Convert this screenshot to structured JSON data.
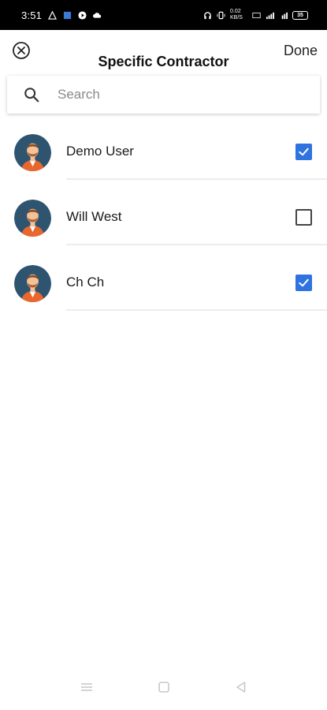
{
  "status_bar": {
    "time": "3:51",
    "network_text": "0.02 KB/S",
    "battery": "35"
  },
  "header": {
    "close_icon": "close-circle-icon",
    "title": "Specific Contractor",
    "done_label": "Done"
  },
  "search": {
    "icon": "search-icon",
    "placeholder": "Search",
    "value": ""
  },
  "contractors": [
    {
      "name": "Demo User",
      "checked": true
    },
    {
      "name": "Will West",
      "checked": false
    },
    {
      "name": "Ch Ch",
      "checked": true
    }
  ],
  "colors": {
    "accent": "#2f73e0",
    "avatar_bg": "#2e5470",
    "shirt": "#e8672e",
    "divider": "#ececec"
  },
  "nav_bar": {
    "items": [
      "menu-icon",
      "home-square-icon",
      "back-triangle-icon"
    ]
  }
}
